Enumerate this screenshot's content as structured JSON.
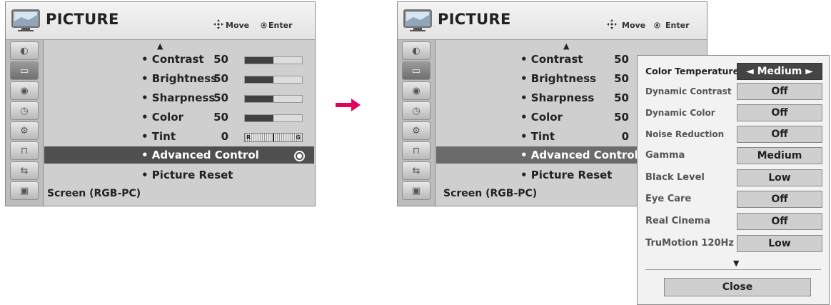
{
  "left_panel": {
    "title": "PICTURE",
    "move_label": "Move",
    "enter_label": "Enter",
    "up_arrow": "▲",
    "settings": [
      {
        "label": "• Contrast",
        "value": "50",
        "level": 0.5
      },
      {
        "label": "• Brightness",
        "value": "50",
        "level": 0.5
      },
      {
        "label": "• Sharpness",
        "value": "50",
        "level": 0.5
      },
      {
        "label": "• Color",
        "value": "50",
        "level": 0.5
      },
      {
        "label": "• Tint",
        "value": "0",
        "tint_r": "R",
        "tint_g": "G"
      }
    ],
    "advanced": "• Advanced Control",
    "reset": "• Picture Reset",
    "screen": "Screen (RGB-PC)"
  },
  "right_panel": {
    "title": "PICTURE",
    "move_label": "Move",
    "enter_label": "Enter",
    "up_arrow": "▲",
    "settings": [
      {
        "label": "• Contrast",
        "value": "50"
      },
      {
        "label": "• Brightness",
        "value": "50"
      },
      {
        "label": "• Sharpness",
        "value": "50"
      },
      {
        "label": "• Color",
        "value": "50"
      },
      {
        "label": "• Tint",
        "value": "0"
      }
    ],
    "advanced": "• Advanced Control",
    "reset": "• Picture Reset",
    "screen": "Screen (RGB-PC)"
  },
  "sidebar_icons": [
    "picture-mode-icon",
    "picture-icon",
    "audio-icon",
    "time-icon",
    "setup-icon",
    "lock-icon",
    "input-icon",
    "usb-icon"
  ],
  "popup": {
    "rows": [
      {
        "label": "Color Temperature",
        "value": "◄ Medium ►"
      },
      {
        "label": "Dynamic Contrast",
        "value": "Off"
      },
      {
        "label": "Dynamic Color",
        "value": "Off"
      },
      {
        "label": "Noise Reduction",
        "value": "Off"
      },
      {
        "label": "Gamma",
        "value": "Medium"
      },
      {
        "label": "Black Level",
        "value": "Low"
      },
      {
        "label": "Eye Care",
        "value": "Off"
      },
      {
        "label": "Real Cinema",
        "value": "Off"
      },
      {
        "label": "TruMotion 120Hz",
        "value": "Low"
      }
    ],
    "down_arrow": "▼",
    "close": "Close"
  },
  "colors": {
    "arrow": "#e6005c",
    "highlight": "#4f4f4f",
    "panel": "#cfcfcf"
  }
}
